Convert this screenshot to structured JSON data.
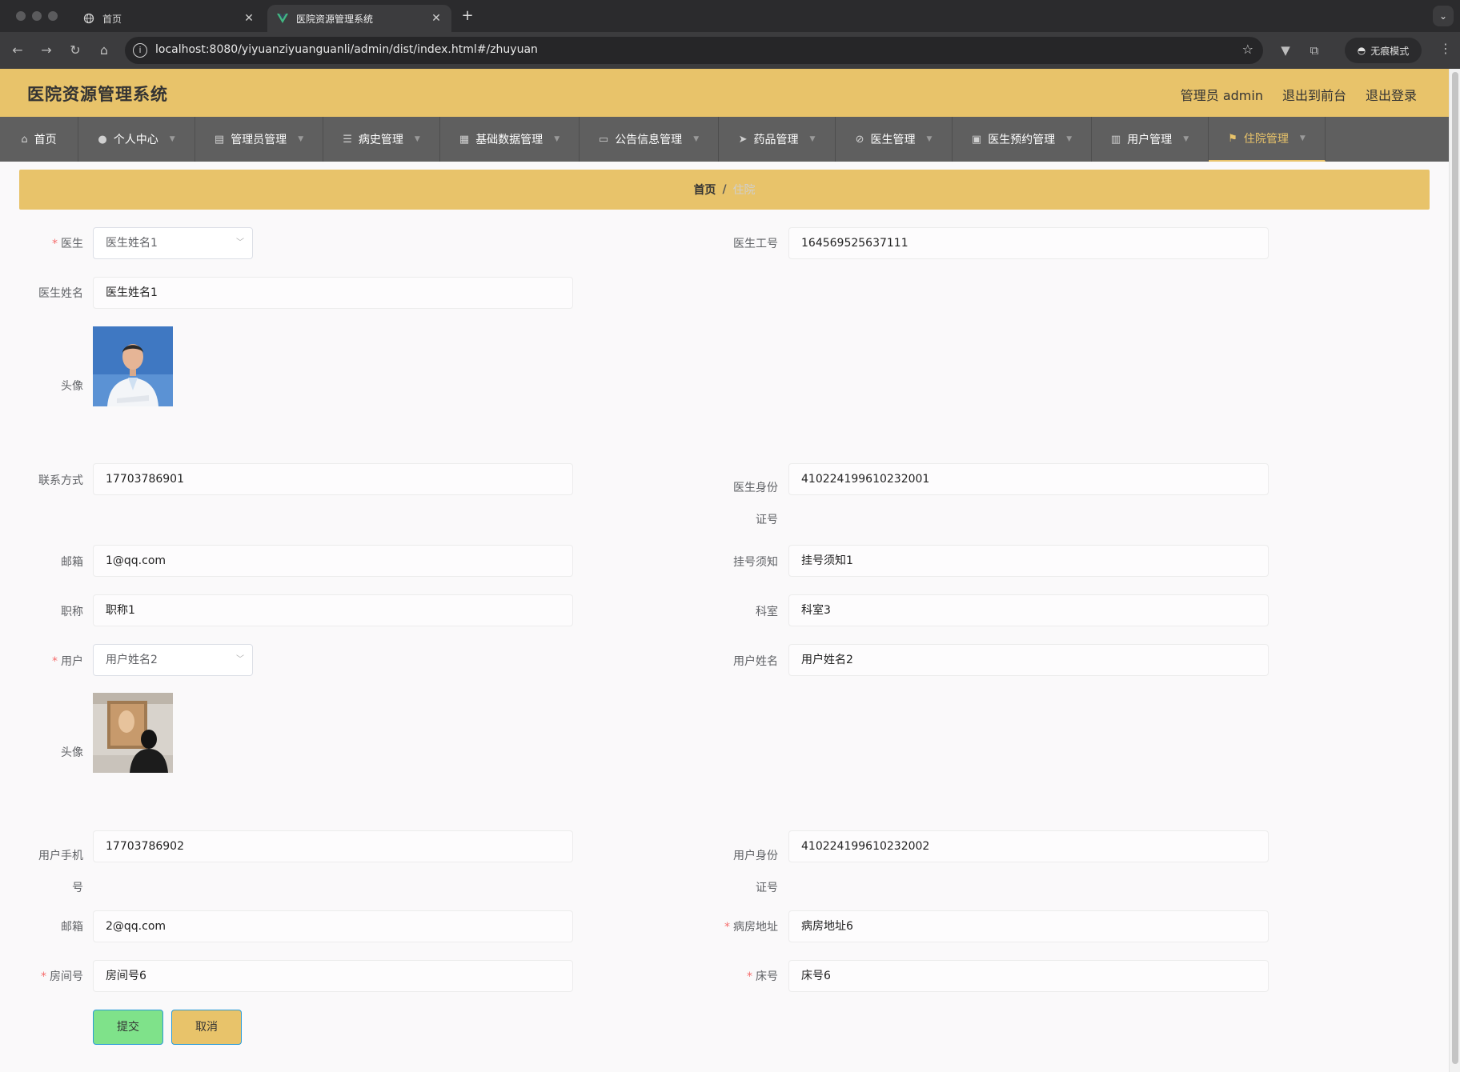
{
  "browser": {
    "tabs": [
      {
        "title": "首页",
        "active": false
      },
      {
        "title": "医院资源管理系统",
        "active": true
      }
    ],
    "url": "localhost:8080/yiyuanziyuanguanli/admin/dist/index.html#/zhuyuan",
    "incognito_label": "无痕模式"
  },
  "header": {
    "title": "医院资源管理系统",
    "links": [
      "管理员 admin",
      "退出到前台",
      "退出登录"
    ]
  },
  "nav": {
    "items": [
      {
        "label": "首页",
        "icon": "home-icon"
      },
      {
        "label": "个人中心",
        "icon": "user-icon"
      },
      {
        "label": "管理员管理",
        "icon": "chart-icon"
      },
      {
        "label": "病史管理",
        "icon": "list-icon"
      },
      {
        "label": "基础数据管理",
        "icon": "grid-icon"
      },
      {
        "label": "公告信息管理",
        "icon": "ticket-icon"
      },
      {
        "label": "药品管理",
        "icon": "send-icon"
      },
      {
        "label": "医生管理",
        "icon": "bell-off-icon"
      },
      {
        "label": "医生预约管理",
        "icon": "briefcase-icon"
      },
      {
        "label": "用户管理",
        "icon": "clipboard-icon"
      },
      {
        "label": "住院管理",
        "icon": "flag-icon"
      }
    ],
    "active_index": 10
  },
  "breadcrumb": {
    "home": "首页",
    "separator": "/",
    "current": "住院"
  },
  "form": {
    "doctor": {
      "label": "医生",
      "value": "医生姓名1"
    },
    "doctor_id": {
      "label": "医生工号",
      "value": "164569525637111"
    },
    "doctor_name": {
      "label": "医生姓名",
      "value": "医生姓名1"
    },
    "doctor_avatar": {
      "label": "头像"
    },
    "doctor_phone": {
      "label": "联系方式",
      "value": "17703786901"
    },
    "doctor_idcard": {
      "label_line1": "医生身份",
      "label_line2": "证号",
      "value": "410224199610232001"
    },
    "doctor_email": {
      "label": "邮箱",
      "value": "1@qq.com"
    },
    "register_notice": {
      "label": "挂号须知",
      "value": "挂号须知1"
    },
    "title": {
      "label": "职称",
      "value": "职称1"
    },
    "department": {
      "label": "科室",
      "value": "科室3"
    },
    "user": {
      "label": "用户",
      "value": "用户姓名2"
    },
    "user_name": {
      "label": "用户姓名",
      "value": "用户姓名2"
    },
    "user_avatar": {
      "label": "头像"
    },
    "user_phone": {
      "label_line1": "用户手机",
      "label_line2": "号",
      "value": "17703786902"
    },
    "user_idcard": {
      "label_line1": "用户身份",
      "label_line2": "证号",
      "value": "410224199610232002"
    },
    "user_email": {
      "label": "邮箱",
      "value": "2@qq.com"
    },
    "ward_address": {
      "label": "病房地址",
      "value": "病房地址6"
    },
    "room_no": {
      "label": "房间号",
      "value": "房间号6"
    },
    "bed_no": {
      "label": "床号",
      "value": "床号6"
    },
    "submit_label": "提交",
    "cancel_label": "取消"
  },
  "colors": {
    "accent": "#e8c36a",
    "nav_bg": "#5f5f5f",
    "submit_bg": "#7fe28a",
    "required": "#f56c6c"
  }
}
